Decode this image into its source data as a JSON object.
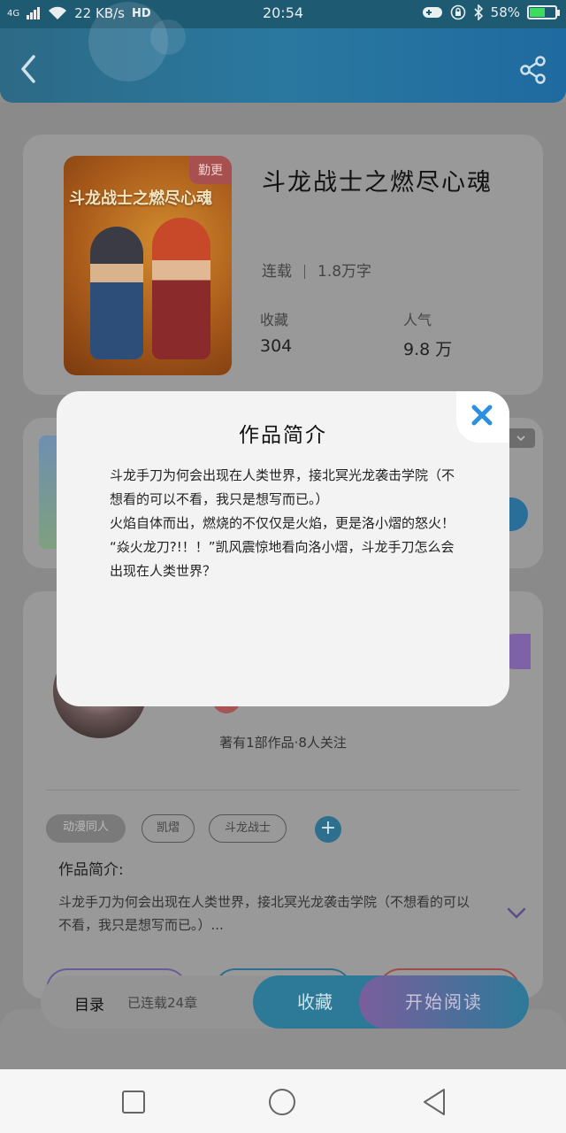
{
  "status_bar": {
    "network": "4G",
    "speed": "22 KB/s",
    "hd": "HD",
    "time": "20:54",
    "battery": "58%",
    "battery_level": 0.58
  },
  "book": {
    "cover_badge": "勤更",
    "cover_title": "斗龙战士之燃尽心魂",
    "title": "斗龙战士之燃尽心魂",
    "status": "连载",
    "word_count": "1.8万字",
    "stats": [
      {
        "label": "收藏",
        "value": "304"
      },
      {
        "label": "人气",
        "value": "9.8 万"
      }
    ]
  },
  "author": {
    "meta": "著有1部作品·8人关注"
  },
  "tags": [
    "动漫同人",
    "凯熠",
    "斗龙战士"
  ],
  "intro": {
    "heading": "作品简介:",
    "snippet": "斗龙手刀为何会出现在人类世界，接北冥光龙袭击学院（不想看的可以不看，我只是想写而已。）..."
  },
  "bottom_bar": {
    "toc_label": "目录",
    "chapters": "已连载24章",
    "favorite_label": "收藏",
    "read_label": "开始阅读"
  },
  "modal": {
    "title": "作品简介",
    "paragraphs": [
      "斗龙手刀为何会出现在人类世界，接北冥光龙袭击学院（不想看的可以不看，我只是想写而已。）",
      "火焰自体而出，燃烧的不仅仅是火焰，更是洛小熠的怒火！",
      "“焱火龙刀?!！！”凯风震惊地看向洛小熠，斗龙手刀怎么会出现在人类世界？"
    ]
  },
  "colors": {
    "header": "#2a78a0",
    "accent": "#2c7a98",
    "purple": "#7a5e9c",
    "close": "#2d8fe0",
    "battery_fill": "#3ddc5a"
  }
}
